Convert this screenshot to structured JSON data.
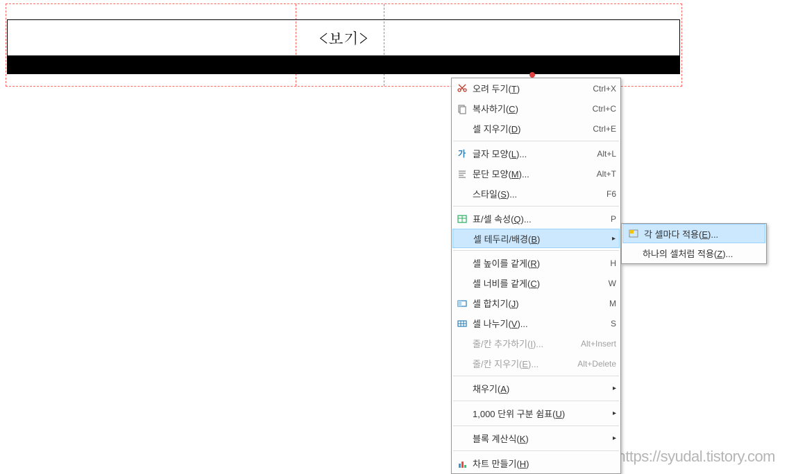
{
  "document": {
    "header_label": "<보기>"
  },
  "context_menu": {
    "items": [
      {
        "icon": "cut",
        "label": "오려 두기(",
        "key": "T",
        "suffix": ")",
        "shortcut": "Ctrl+X"
      },
      {
        "icon": "copy",
        "label": "복사하기(",
        "key": "C",
        "suffix": ")",
        "shortcut": "Ctrl+C"
      },
      {
        "icon": "",
        "label": "셀 지우기(",
        "key": "D",
        "suffix": ")",
        "shortcut": "Ctrl+E"
      },
      {
        "separator": true
      },
      {
        "icon": "font",
        "label": "글자 모양(",
        "key": "L",
        "suffix": ")...",
        "shortcut": "Alt+L"
      },
      {
        "icon": "para",
        "label": "문단 모양(",
        "key": "M",
        "suffix": ")...",
        "shortcut": "Alt+T"
      },
      {
        "icon": "",
        "label": "스타일(",
        "key": "S",
        "suffix": ")...",
        "shortcut": "F6"
      },
      {
        "separator": true
      },
      {
        "icon": "table",
        "label": "표/셀 속성(",
        "key": "Q",
        "suffix": ")...",
        "shortcut": "P"
      },
      {
        "icon": "",
        "label": "셀 테두리/배경(",
        "key": "B",
        "suffix": ")",
        "shortcut": "",
        "arrow": true,
        "highlighted": true
      },
      {
        "separator": true
      },
      {
        "icon": "",
        "label": "셀 높이를 같게(",
        "key": "R",
        "suffix": ")",
        "shortcut": "H"
      },
      {
        "icon": "",
        "label": "셀 너비를 같게(",
        "key": "C",
        "suffix": ")",
        "shortcut": "W"
      },
      {
        "icon": "merge",
        "label": "셀 합치기(",
        "key": "J",
        "suffix": ")",
        "shortcut": "M"
      },
      {
        "icon": "split",
        "label": "셀 나누기(",
        "key": "V",
        "suffix": ")...",
        "shortcut": "S"
      },
      {
        "icon": "",
        "label": "줄/칸 추가하기(",
        "key": "I",
        "suffix": ")...",
        "shortcut": "Alt+Insert",
        "disabled": true
      },
      {
        "icon": "",
        "label": "줄/칸 지우기(",
        "key": "E",
        "suffix": ")...",
        "shortcut": "Alt+Delete",
        "disabled": true
      },
      {
        "separator": true
      },
      {
        "icon": "",
        "label": "채우기(",
        "key": "A",
        "suffix": ")",
        "shortcut": "",
        "arrow": true
      },
      {
        "separator": true
      },
      {
        "icon": "",
        "label": "1,000 단위 구분 쉼표(",
        "key": "U",
        "suffix": ")",
        "shortcut": "",
        "arrow": true
      },
      {
        "separator": true
      },
      {
        "icon": "",
        "label": "블록 계산식(",
        "key": "K",
        "suffix": ")",
        "shortcut": "",
        "arrow": true
      },
      {
        "separator": true
      },
      {
        "icon": "chart",
        "label": "차트 만들기(",
        "key": "H",
        "suffix": ")",
        "shortcut": ""
      }
    ]
  },
  "submenu": {
    "items": [
      {
        "icon": "cell",
        "label": "각 셀마다 적용(",
        "key": "E",
        "suffix": ")...",
        "highlighted": true
      },
      {
        "icon": "",
        "label": "하나의 셀처럼 적용(",
        "key": "Z",
        "suffix": ")..."
      }
    ]
  },
  "watermark": "https://syudal.tistory.com"
}
